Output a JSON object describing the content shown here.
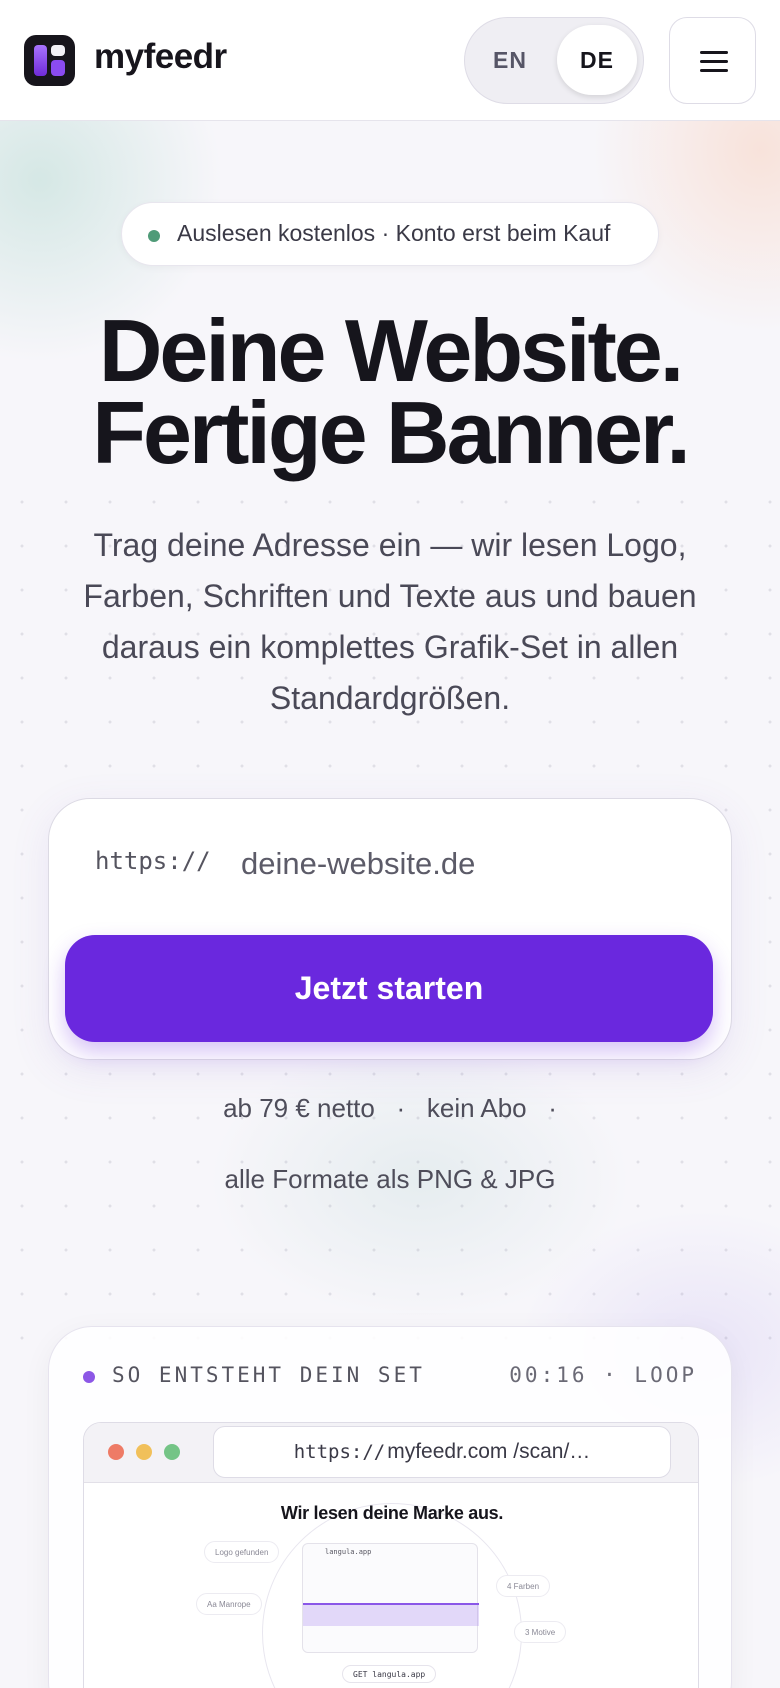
{
  "header": {
    "logo_name": "myfeedr",
    "lang": {
      "en": "EN",
      "de": "DE",
      "active": "DE"
    },
    "menu_icon": "hamburger-menu-icon"
  },
  "hero": {
    "badge": "Auslesen kostenlos · Konto erst beim Kauf",
    "title_line1": "Deine Website.",
    "title_line2": "Fertige Banner.",
    "lead": "Trag deine Adresse ein — wir lesen Logo, Farben, Schriften und Texte aus und bauen daraus ein komplettes Grafik-Set in allen Standardgrößen."
  },
  "form": {
    "prefix": "https://",
    "placeholder": "deine-website.de",
    "cta": "Jetzt starten"
  },
  "meta": {
    "line1": "ab 79 € netto   ·   kein Abo   ·",
    "line2": "alle Formate als PNG & JPG"
  },
  "demo": {
    "title": "SO ENTSTEHT DEIN SET",
    "timer": "00:16 · LOOP",
    "address_scheme": "https://",
    "address_rest": "myfeedr.com /scan/…",
    "scan_title": "Wir lesen deine Marke aus.",
    "mini_domain": "langula.app",
    "tags": {
      "logo": "Logo gefunden",
      "font": "Aa  Manrope",
      "colors": "4 Farben",
      "motifs": "3 Motive",
      "get": "GET langula.app"
    }
  },
  "colors": {
    "accent": "#6a28de",
    "status_green": "#4f9b78",
    "traffic_red": "#ee7b66",
    "traffic_yellow": "#f1c05a",
    "traffic_green": "#74c486"
  }
}
